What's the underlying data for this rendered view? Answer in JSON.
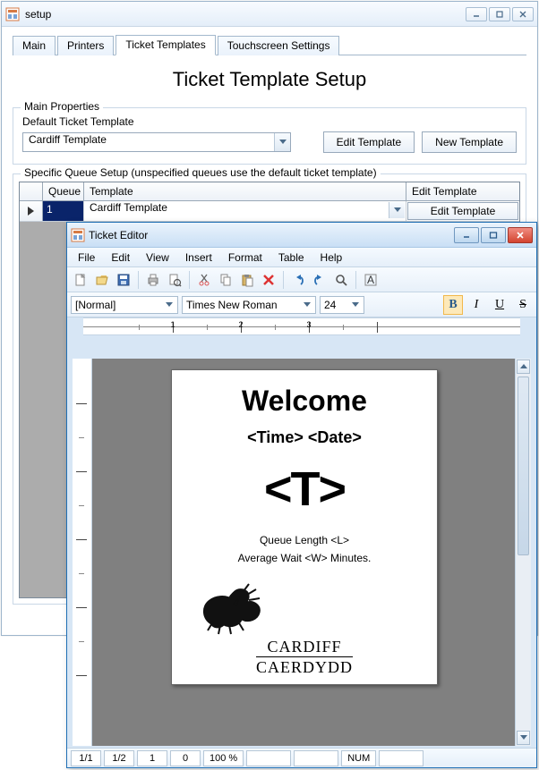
{
  "setup": {
    "title": "setup",
    "tabs": [
      "Main",
      "Printers",
      "Ticket Templates",
      "Touchscreen Settings"
    ],
    "active_tab": 2,
    "page_title": "Ticket Template Setup",
    "main_props": {
      "legend": "Main Properties",
      "label": "Default Ticket Template",
      "selected": "Cardiff Template",
      "edit_btn": "Edit Template",
      "new_btn": "New Template"
    },
    "queue_section": {
      "legend": "Specific Queue Setup (unspecified queues use the default ticket template)",
      "headers": {
        "queue": "Queue",
        "template": "Template",
        "edit": "Edit Template"
      },
      "rows": [
        {
          "queue": "1",
          "template": "Cardiff Template",
          "edit": "Edit Template"
        }
      ]
    }
  },
  "editor": {
    "title": "Ticket Editor",
    "menu": [
      "File",
      "Edit",
      "View",
      "Insert",
      "Format",
      "Table",
      "Help"
    ],
    "format": {
      "style": "[Normal]",
      "font": "Times New Roman",
      "size": "24"
    },
    "document": {
      "welcome": "Welcome",
      "timedate": "<Time>   <Date>",
      "big": "<T>",
      "queue_line": "Queue Length <L>",
      "wait_line": "Average Wait <W> Minutes.",
      "logo1": "CARDIFF",
      "logo2": "CAERDYDD"
    },
    "status": {
      "page": "1/1",
      "sec": "1/2",
      "line": "1",
      "col": "0",
      "zoom": "100 %",
      "num": "NUM"
    }
  }
}
